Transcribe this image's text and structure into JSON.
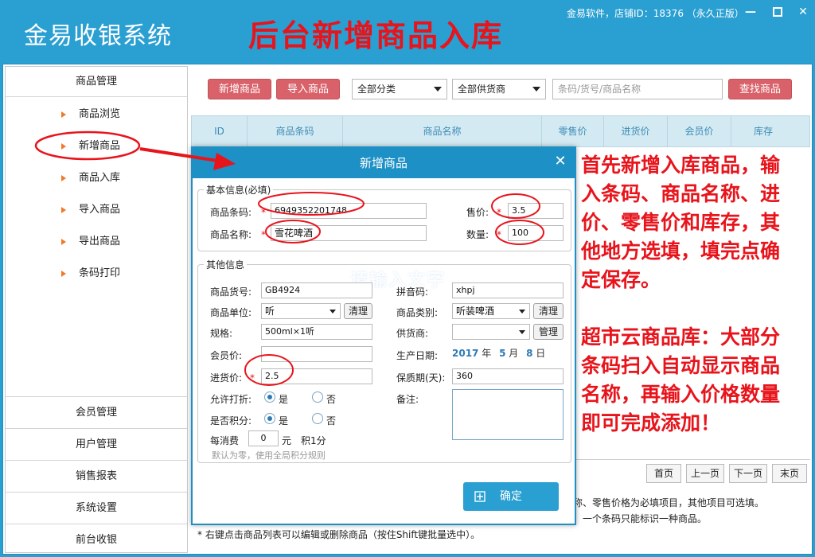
{
  "window": {
    "app_title": "金易收银系统",
    "promo_title": "后台新增商品入库",
    "shop_info": "金易软件，店铺ID：18376 （永久正版）"
  },
  "sidebar": {
    "group_top": "商品管理",
    "items": [
      {
        "label": "商品浏览"
      },
      {
        "label": "新增商品"
      },
      {
        "label": "商品入库"
      },
      {
        "label": "导入商品"
      },
      {
        "label": "导出商品"
      },
      {
        "label": "条码打印"
      }
    ],
    "bottom": [
      {
        "label": "会员管理"
      },
      {
        "label": "用户管理"
      },
      {
        "label": "销售报表"
      },
      {
        "label": "系统设置"
      },
      {
        "label": "前台收银"
      }
    ]
  },
  "toolbar": {
    "add_label": "新增商品",
    "import_label": "导入商品",
    "category_value": "全部分类",
    "supplier_value": "全部供货商",
    "search_placeholder": "条码/货号/商品名称",
    "search_button": "查找商品"
  },
  "table": {
    "columns": [
      "ID",
      "商品条码",
      "商品名称",
      "零售价",
      "进货价",
      "会员价",
      "库存"
    ]
  },
  "pagination": {
    "first": "首页",
    "prev": "上一页",
    "next": "下一页",
    "last": "末页"
  },
  "notes": {
    "line1": "称、零售价格为必填项目，其他项目可选填。",
    "line2": "，一个条码只能标识一种商品。",
    "line3": "* 右键点击商品列表可以编辑或删除商品（按住Shift键批量选中）。"
  },
  "annotations": {
    "instruction": [
      "首先新增入库商品，输",
      "入条码、商品名称、进",
      "价、零售价和库存，其",
      "他地方选填，填完点确",
      "定保存。"
    ],
    "tip": [
      "超市云商品库：大部分",
      "条码扫入自动显示商品",
      "名称，再输入价格数量",
      "即可完成添加！"
    ]
  },
  "dialog": {
    "title": "新增商品",
    "basic_legend": "基本信息(必填)",
    "barcode_label": "商品条码:",
    "barcode_value": "6949352201748",
    "name_label": "商品名称:",
    "name_value": "雪花啤酒",
    "price_label": "售价:",
    "price_value": "3.5",
    "qty_label": "数量:",
    "qty_value": "100",
    "other_legend": "其他信息",
    "sku_label": "商品货号:",
    "sku_value": "GB4924",
    "pinyin_label": "拼音码:",
    "pinyin_value": "xhpj",
    "unit_label": "商品单位:",
    "unit_value": "听",
    "clear_label": "清理",
    "category_label": "商品类别:",
    "category_value": "听装啤酒",
    "spec_label": "规格:",
    "spec_value": "500ml×1听",
    "supplier_label": "供货商:",
    "manage_label": "管理",
    "member_price_label": "会员价:",
    "production_label": "生产日期:",
    "date_year": "2017",
    "date_year_unit": "年",
    "date_month": "5",
    "date_month_unit": "月",
    "date_day": "8",
    "date_day_unit": "日",
    "cost_label": "进货价:",
    "cost_value": "2.5",
    "shelf_label": "保质期(天):",
    "shelf_value": "360",
    "discount_label": "允许打折:",
    "points_label": "是否积分:",
    "yes_label": "是",
    "no_label": "否",
    "remark_label": "备注:",
    "per_label": "每消费",
    "per_value": "0",
    "yuan_label": "元",
    "points_text": "积1分",
    "hint": "默认为零，使用全局积分规则",
    "ok_label": "确定",
    "watermark": "请输入文字"
  }
}
